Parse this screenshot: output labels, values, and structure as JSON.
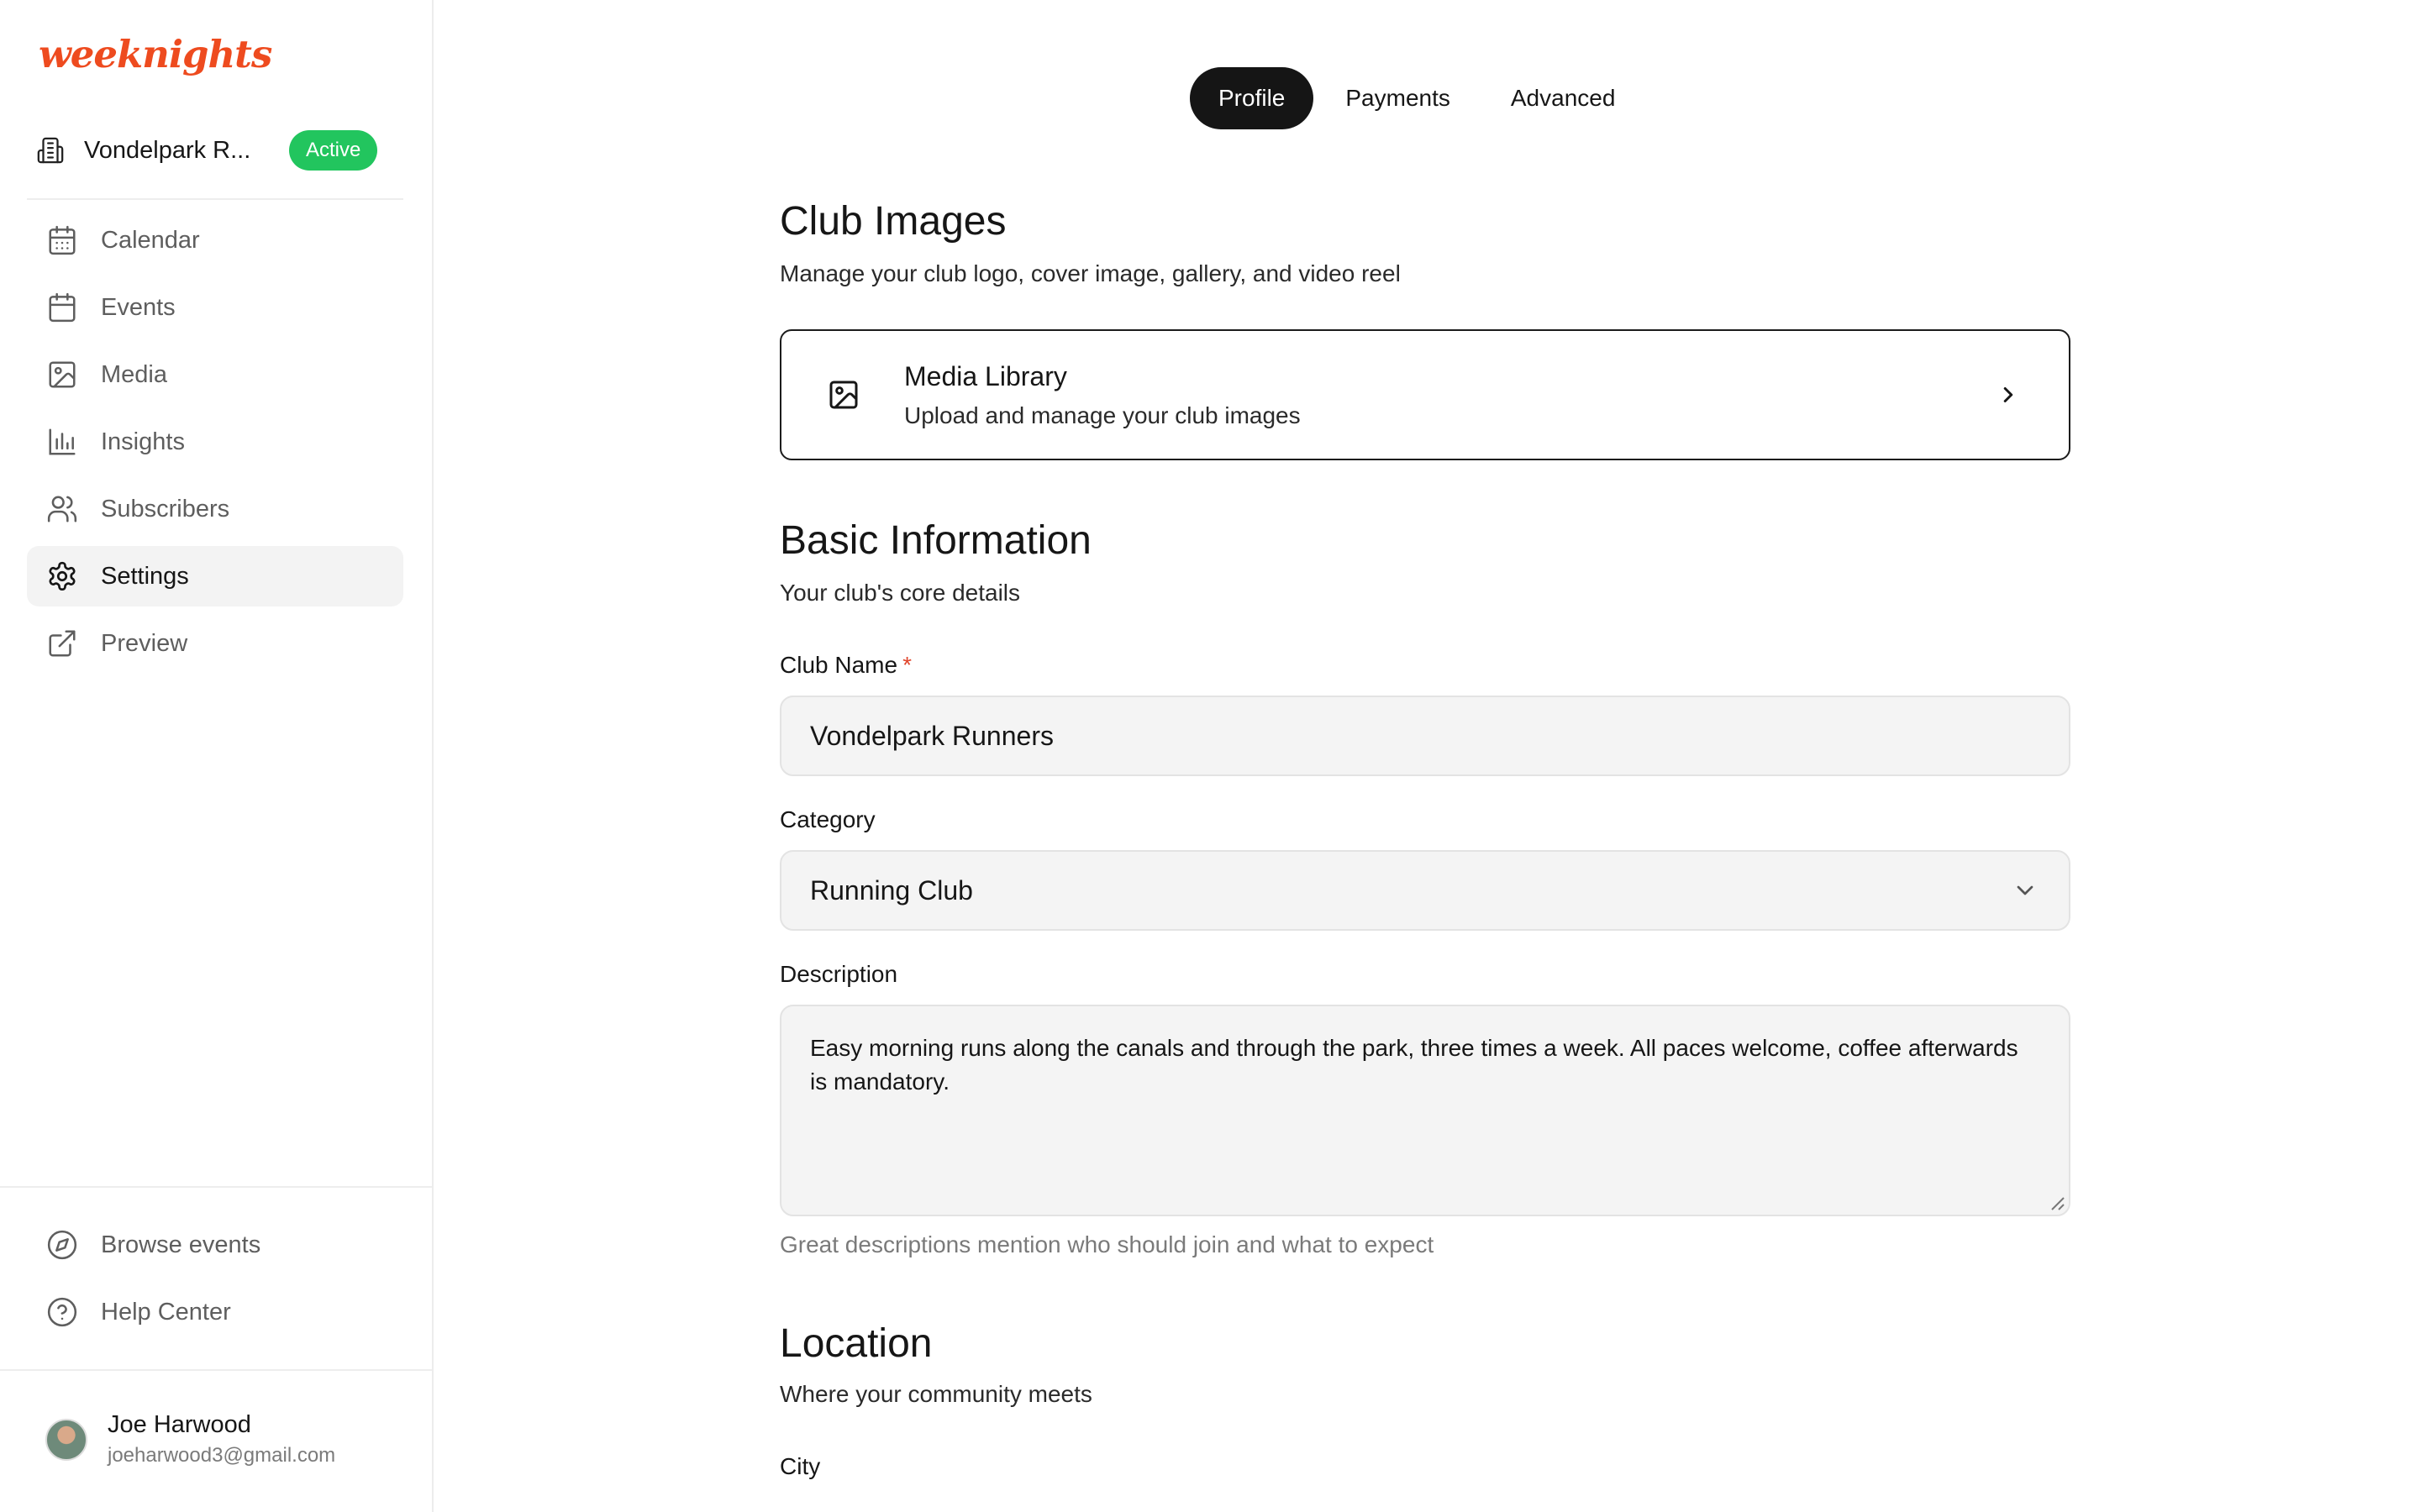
{
  "app": {
    "logo": "weeknights"
  },
  "sidebar": {
    "club": {
      "name": "Vondelpark R...",
      "status": "Active",
      "icon": "building-icon"
    },
    "nav": [
      {
        "label": "Calendar",
        "icon": "calendar-grid-icon",
        "active": false
      },
      {
        "label": "Events",
        "icon": "calendar-icon",
        "active": false
      },
      {
        "label": "Media",
        "icon": "image-icon",
        "active": false
      },
      {
        "label": "Insights",
        "icon": "bar-chart-icon",
        "active": false
      },
      {
        "label": "Subscribers",
        "icon": "users-icon",
        "active": false
      },
      {
        "label": "Settings",
        "icon": "gear-icon",
        "active": true
      },
      {
        "label": "Preview",
        "icon": "external-link-icon",
        "active": false
      }
    ],
    "bottom_nav": [
      {
        "label": "Browse events",
        "icon": "compass-icon"
      },
      {
        "label": "Help Center",
        "icon": "help-circle-icon"
      }
    ],
    "user": {
      "name": "Joe Harwood",
      "email": "joeharwood3@gmail.com"
    }
  },
  "tabs": [
    {
      "label": "Profile",
      "active": true
    },
    {
      "label": "Payments",
      "active": false
    },
    {
      "label": "Advanced",
      "active": false
    }
  ],
  "club_images": {
    "title": "Club Images",
    "subtitle": "Manage your club logo, cover image, gallery, and video reel",
    "media_library": {
      "title": "Media Library",
      "subtitle": "Upload and manage your club images"
    }
  },
  "basic_info": {
    "title": "Basic Information",
    "subtitle": "Your club's core details",
    "club_name": {
      "label": "Club Name",
      "required_mark": "*",
      "value": "Vondelpark Runners"
    },
    "category": {
      "label": "Category",
      "value": "Running Club"
    },
    "description": {
      "label": "Description",
      "value": "Easy morning runs along the canals and through the park, three times a week. All paces welcome, coffee afterwards is mandatory.",
      "hint": "Great descriptions mention who should join and what to expect"
    }
  },
  "location": {
    "title": "Location",
    "subtitle": "Where your community meets",
    "city": {
      "label": "City"
    }
  },
  "colors": {
    "brand": "#ee4b1f",
    "active_badge": "#22c55e",
    "tab_active": "#151515"
  }
}
